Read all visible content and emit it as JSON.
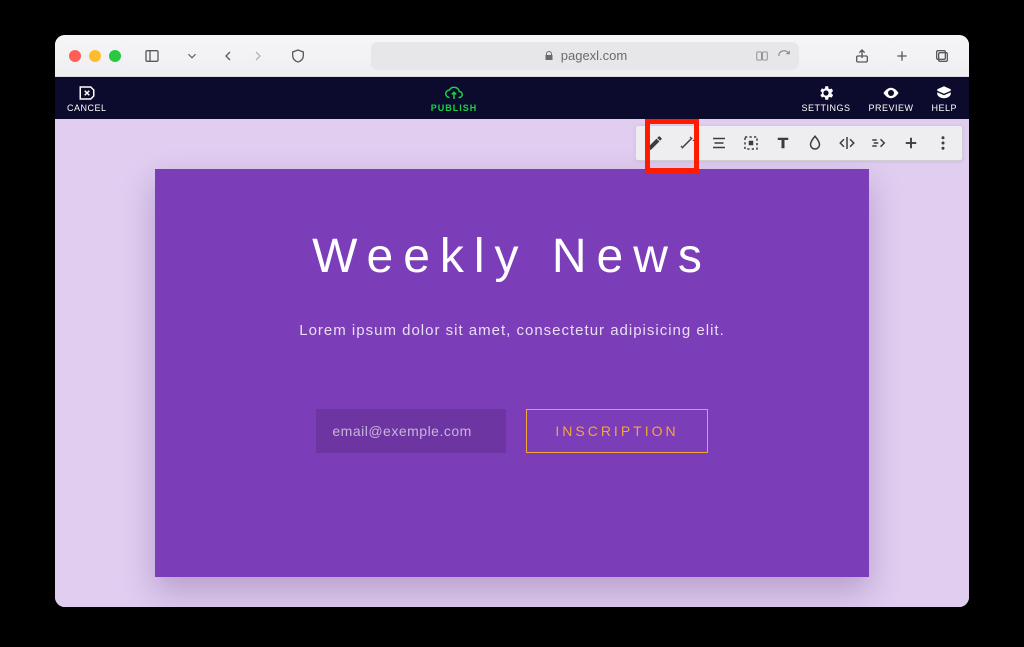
{
  "browser": {
    "url_host": "pagexl.com"
  },
  "appbar": {
    "cancel": "CANCEL",
    "publish": "PUBLISH",
    "settings": "SETTINGS",
    "preview": "PREVIEW",
    "help": "HELP"
  },
  "toolbar": {
    "icons": [
      "edit-pencil",
      "magic-wand",
      "align",
      "bounding-box",
      "type",
      "drop",
      "code-split",
      "motion",
      "add",
      "kebab-menu"
    ]
  },
  "content": {
    "heading": "Weekly News",
    "subheading": "Lorem ipsum dolor sit amet, consectetur adipisicing elit.",
    "email_placeholder": "email@exemple.com",
    "button_label": "INSCRIPTION"
  },
  "colors": {
    "canvas": "#e0cdf0",
    "card": "#7b3db8",
    "accent": "#f4a63a",
    "publish": "#19d147",
    "appbar": "#0c0b2d",
    "highlight": "#ff1b00"
  }
}
